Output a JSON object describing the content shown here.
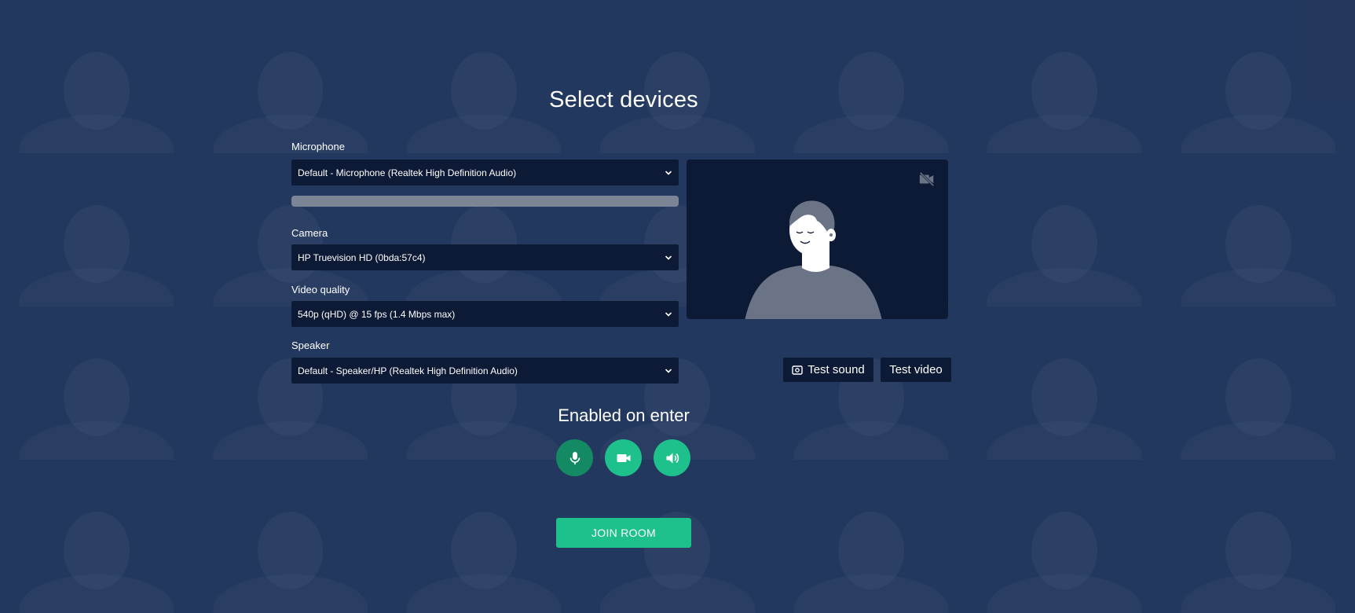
{
  "page": {
    "title": "Select devices"
  },
  "microphone": {
    "label": "Microphone",
    "selected": "Default - Microphone (Realtek High Definition Audio)",
    "level": 0.0
  },
  "camera": {
    "label": "Camera",
    "selected": "HP Truevision HD (0bda:57c4)"
  },
  "video_quality": {
    "label": "Video quality",
    "selected": "540p (qHD) @ 15 fps (1.4 Mbps max)"
  },
  "speaker": {
    "label": "Speaker",
    "selected": "Default - Speaker/HP (Realtek High Definition Audio)"
  },
  "preview": {
    "camera_off_icon": "video-off-icon",
    "placeholder_icon": "person-avatar-icon"
  },
  "tests": {
    "sound_label": "Test sound",
    "video_label": "Test video"
  },
  "enabled_on_enter": {
    "title": "Enabled on enter",
    "toggles": [
      {
        "name": "microphone",
        "icon": "microphone-icon"
      },
      {
        "name": "camera",
        "icon": "video-camera-icon"
      },
      {
        "name": "speaker",
        "icon": "speaker-icon"
      }
    ]
  },
  "join": {
    "label": "JOIN ROOM"
  },
  "colors": {
    "accent": "#1ec08b",
    "accent_dark": "#138a63",
    "panel": "#0d1a35",
    "background": "#2c4066"
  }
}
